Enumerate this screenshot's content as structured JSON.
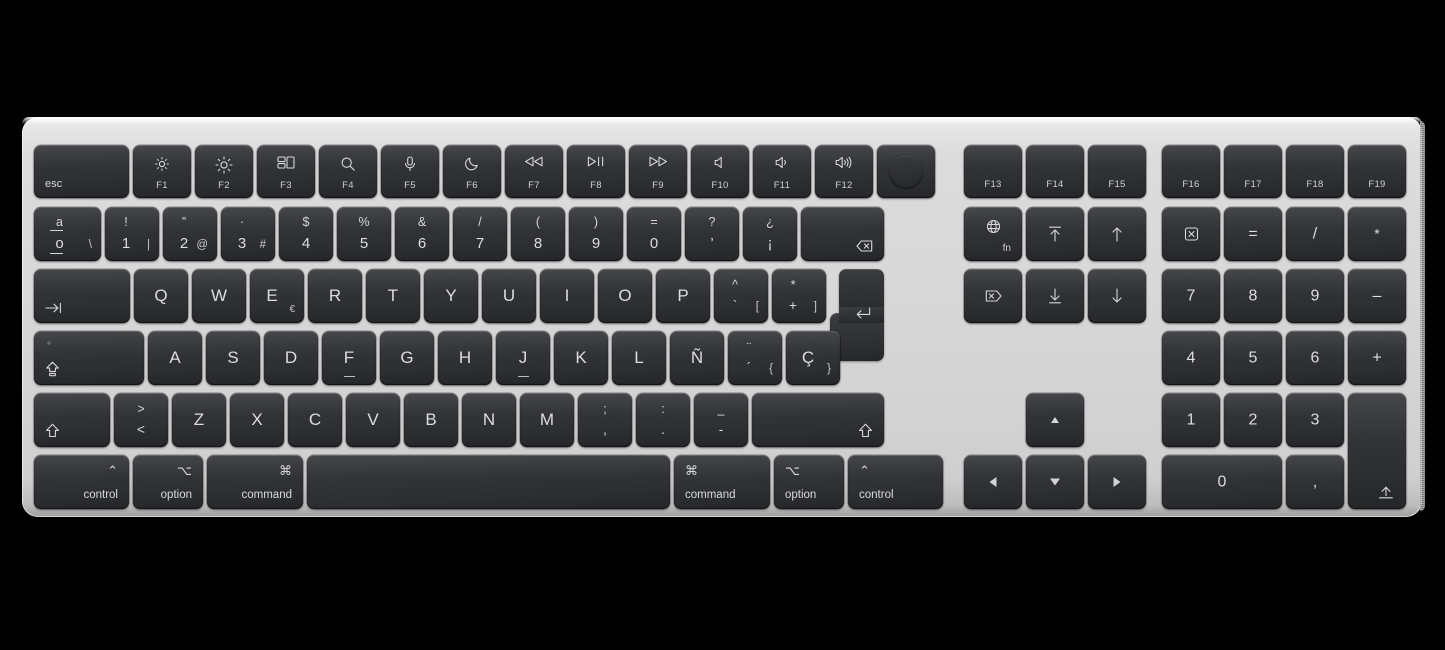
{
  "device": {
    "name": "Magic Keyboard with Touch ID and Numeric Keypad",
    "layout": "Spanish",
    "body_color": "#d7d7d7",
    "key_color": "#2f3134",
    "legend_color": "#d8d9da"
  },
  "rows": {
    "function_row": [
      {
        "id": "esc",
        "label": "esc"
      },
      {
        "id": "f1",
        "fn": "F1",
        "icon": "brightness-down-icon"
      },
      {
        "id": "f2",
        "fn": "F2",
        "icon": "brightness-up-icon"
      },
      {
        "id": "f3",
        "fn": "F3",
        "icon": "mission-control-icon"
      },
      {
        "id": "f4",
        "fn": "F4",
        "icon": "spotlight-search-icon"
      },
      {
        "id": "f5",
        "fn": "F5",
        "icon": "dictation-microphone-icon"
      },
      {
        "id": "f6",
        "fn": "F6",
        "icon": "do-not-disturb-moon-icon"
      },
      {
        "id": "f7",
        "fn": "F7",
        "icon": "rewind-icon"
      },
      {
        "id": "f8",
        "fn": "F8",
        "icon": "play-pause-icon"
      },
      {
        "id": "f9",
        "fn": "F9",
        "icon": "fast-forward-icon"
      },
      {
        "id": "f10",
        "fn": "F10",
        "icon": "mute-icon"
      },
      {
        "id": "f11",
        "fn": "F11",
        "icon": "volume-down-icon"
      },
      {
        "id": "f12",
        "fn": "F12",
        "icon": "volume-up-icon"
      },
      {
        "id": "touchid",
        "fn": "",
        "icon": "touch-id-icon"
      },
      {
        "id": "f13",
        "fn": "F13"
      },
      {
        "id": "f14",
        "fn": "F14"
      },
      {
        "id": "f15",
        "fn": "F15"
      },
      {
        "id": "f16",
        "fn": "F16"
      },
      {
        "id": "f17",
        "fn": "F17"
      },
      {
        "id": "f18",
        "fn": "F18"
      },
      {
        "id": "f19",
        "fn": "F19"
      }
    ],
    "number_row": [
      {
        "id": "ordinal",
        "up": "a",
        "lo": "o",
        "alt": "\\"
      },
      {
        "id": "1",
        "up": "!",
        "lo": "1",
        "alt": "|"
      },
      {
        "id": "2",
        "up": "”",
        "lo": "2",
        "alt": "@"
      },
      {
        "id": "3",
        "up": "·",
        "lo": "3",
        "alt": "#"
      },
      {
        "id": "4",
        "up": "$",
        "lo": "4",
        "alt": ""
      },
      {
        "id": "5",
        "up": "%",
        "lo": "5",
        "alt": ""
      },
      {
        "id": "6",
        "up": "&",
        "lo": "6",
        "alt": ""
      },
      {
        "id": "7",
        "up": "/",
        "lo": "7",
        "alt": ""
      },
      {
        "id": "8",
        "up": "(",
        "lo": "8",
        "alt": ""
      },
      {
        "id": "9",
        "up": ")",
        "lo": "9",
        "alt": ""
      },
      {
        "id": "0",
        "up": "=",
        "lo": "0",
        "alt": ""
      },
      {
        "id": "apostrophe",
        "up": "?",
        "lo": "’",
        "alt": ""
      },
      {
        "id": "inverted-question",
        "up": "¿",
        "lo": "¡",
        "alt": ""
      },
      {
        "id": "delete",
        "icon": "delete-backspace-icon"
      }
    ],
    "qwerty_row": [
      {
        "id": "tab",
        "icon": "tab-icon"
      },
      {
        "id": "q",
        "label": "Q"
      },
      {
        "id": "w",
        "label": "W"
      },
      {
        "id": "e",
        "label": "E",
        "alt": "€"
      },
      {
        "id": "r",
        "label": "R"
      },
      {
        "id": "t",
        "label": "T"
      },
      {
        "id": "y",
        "label": "Y"
      },
      {
        "id": "u",
        "label": "U"
      },
      {
        "id": "i",
        "label": "I"
      },
      {
        "id": "o",
        "label": "O"
      },
      {
        "id": "p",
        "label": "P"
      },
      {
        "id": "grave",
        "up": "^",
        "lo": "`",
        "alt": "["
      },
      {
        "id": "plus",
        "up": "*",
        "lo": "+",
        "alt": "]"
      },
      {
        "id": "return",
        "icon": "return-icon"
      }
    ],
    "home_row": [
      {
        "id": "capslock",
        "icon": "caps-lock-icon"
      },
      {
        "id": "a",
        "label": "A"
      },
      {
        "id": "s",
        "label": "S"
      },
      {
        "id": "d",
        "label": "D"
      },
      {
        "id": "f",
        "label": "F"
      },
      {
        "id": "g",
        "label": "G"
      },
      {
        "id": "h",
        "label": "H"
      },
      {
        "id": "j",
        "label": "J"
      },
      {
        "id": "k",
        "label": "K"
      },
      {
        "id": "l",
        "label": "L"
      },
      {
        "id": "enye",
        "label": "Ñ"
      },
      {
        "id": "diaeresis",
        "up": "¨",
        "lo": "´",
        "alt": "{"
      },
      {
        "id": "ccedilla",
        "label": "Ç",
        "alt": "}"
      }
    ],
    "shift_row": [
      {
        "id": "shift-left",
        "icon": "shift-icon"
      },
      {
        "id": "less-greater",
        "up": ">",
        "lo": "<"
      },
      {
        "id": "z",
        "label": "Z"
      },
      {
        "id": "x",
        "label": "X"
      },
      {
        "id": "c",
        "label": "C"
      },
      {
        "id": "v",
        "label": "V"
      },
      {
        "id": "b",
        "label": "B"
      },
      {
        "id": "n",
        "label": "N"
      },
      {
        "id": "m",
        "label": "M"
      },
      {
        "id": "comma",
        "up": ";",
        "lo": ","
      },
      {
        "id": "period",
        "up": ":",
        "lo": "."
      },
      {
        "id": "minus",
        "up": "_",
        "lo": "-"
      },
      {
        "id": "shift-right",
        "icon": "shift-icon"
      }
    ],
    "bottom_row": [
      {
        "id": "control-left",
        "sym": "⌃",
        "word": "control",
        "align": "right"
      },
      {
        "id": "option-left",
        "sym": "⌥",
        "word": "option",
        "align": "right"
      },
      {
        "id": "command-left",
        "sym": "⌘",
        "word": "command",
        "align": "right"
      },
      {
        "id": "space",
        "label": ""
      },
      {
        "id": "command-right",
        "sym": "⌘",
        "word": "command",
        "align": "left"
      },
      {
        "id": "option-right",
        "sym": "⌥",
        "word": "option",
        "align": "left"
      },
      {
        "id": "control-right",
        "sym": "⌃",
        "word": "control",
        "align": "left"
      }
    ],
    "nav_cluster": [
      {
        "id": "fn",
        "label": "fn",
        "icon": "globe-icon"
      },
      {
        "id": "page-up",
        "icon": "page-up-icon"
      },
      {
        "id": "home-up",
        "icon": "arrow-up-icon"
      },
      {
        "id": "forward-delete",
        "icon": "forward-delete-icon"
      },
      {
        "id": "page-down",
        "icon": "page-down-icon"
      },
      {
        "id": "arrow-down-nav",
        "icon": "arrow-down-icon"
      },
      {
        "id": "arrow-up",
        "icon": "arrow-up-triangle-icon"
      },
      {
        "id": "arrow-left",
        "icon": "arrow-left-triangle-icon"
      },
      {
        "id": "arrow-down",
        "icon": "arrow-down-triangle-icon"
      },
      {
        "id": "arrow-right",
        "icon": "arrow-right-triangle-icon"
      }
    ],
    "numpad": [
      {
        "id": "num-clear",
        "icon": "clear-icon"
      },
      {
        "id": "num-equals",
        "label": "="
      },
      {
        "id": "num-divide",
        "label": "/"
      },
      {
        "id": "num-multiply",
        "label": "*"
      },
      {
        "id": "num-7",
        "label": "7"
      },
      {
        "id": "num-8",
        "label": "8"
      },
      {
        "id": "num-9",
        "label": "9"
      },
      {
        "id": "num-minus",
        "label": "–"
      },
      {
        "id": "num-4",
        "label": "4"
      },
      {
        "id": "num-5",
        "label": "5"
      },
      {
        "id": "num-6",
        "label": "6"
      },
      {
        "id": "num-plus",
        "label": "+"
      },
      {
        "id": "num-1",
        "label": "1"
      },
      {
        "id": "num-2",
        "label": "2"
      },
      {
        "id": "num-3",
        "label": "3"
      },
      {
        "id": "num-0",
        "label": "0"
      },
      {
        "id": "num-comma",
        "label": ","
      },
      {
        "id": "num-enter",
        "icon": "numpad-enter-icon"
      }
    ]
  }
}
